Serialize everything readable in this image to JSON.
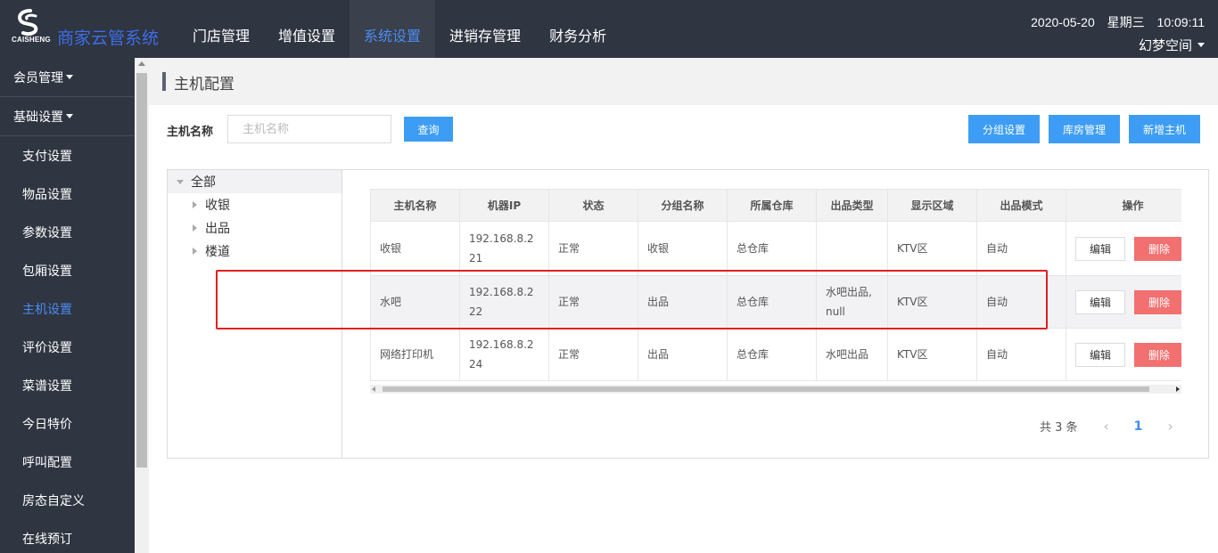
{
  "header": {
    "logo_text": "CAISHENG",
    "brand": "商家云管系统",
    "nav": [
      "门店管理",
      "增值设置",
      "系统设置",
      "进销存管理",
      "财务分析"
    ],
    "active_nav": 2,
    "datetime": "2020-05-20 星期三 10:09:11",
    "user": "幻梦空间"
  },
  "sidebar": {
    "groups": [
      "会员管理",
      "基础设置"
    ],
    "items": [
      "支付设置",
      "物品设置",
      "参数设置",
      "包厢设置",
      "主机设置",
      "评价设置",
      "菜谱设置",
      "今日特价",
      "呼叫配置",
      "房态自定义",
      "在线预订"
    ],
    "active_item": 4
  },
  "page": {
    "title": "主机配置",
    "filter_label": "主机名称",
    "filter_placeholder": "主机名称",
    "filter_value": "",
    "search_button": "查询",
    "group_settings_button": "分组设置",
    "warehouse_button": "库房管理",
    "add_host_button": "新增主机"
  },
  "tree": {
    "root": "全部",
    "children": [
      "收银",
      "出品",
      "楼道"
    ]
  },
  "table": {
    "columns": [
      "主机名称",
      "机器IP",
      "状态",
      "分组名称",
      "所属仓库",
      "出品类型",
      "显示区域",
      "出品模式",
      "操作"
    ],
    "rows": [
      {
        "name": "收银",
        "ip": "192.168.8.221",
        "status": "正常",
        "group": "收银",
        "warehouse": "总仓库",
        "output_type": "",
        "area": "KTV区",
        "mode": "自动"
      },
      {
        "name": "水吧",
        "ip": "192.168.8.222",
        "status": "正常",
        "group": "出品",
        "warehouse": "总仓库",
        "output_type": "水吧出品,null",
        "area": "KTV区",
        "mode": "自动"
      },
      {
        "name": "网络打印机",
        "ip": "192.168.8.224",
        "status": "正常",
        "group": "出品",
        "warehouse": "总仓库",
        "output_type": "水吧出品",
        "area": "KTV区",
        "mode": "自动"
      }
    ],
    "edit_label": "编辑",
    "delete_label": "删除"
  },
  "pagination": {
    "total": "共 3 条",
    "prev": "‹",
    "current": "1",
    "next": "›"
  },
  "colors": {
    "nav_bg": "#2f3541",
    "accent": "#3d9df5",
    "active_text": "#4b8cf4",
    "danger": "#f27070",
    "highlight": "#e02020"
  }
}
